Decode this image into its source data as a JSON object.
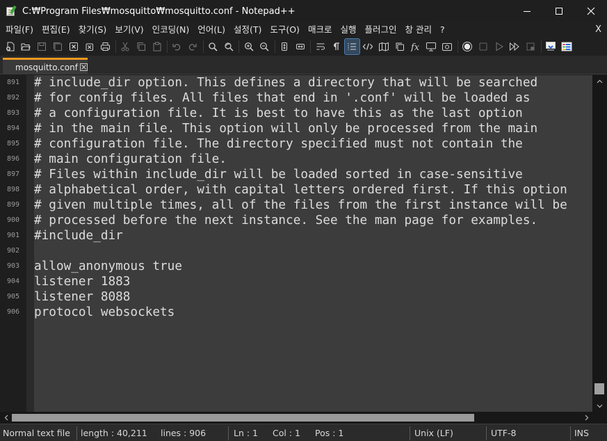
{
  "window": {
    "title": "C:₩Program Files₩mosquitto₩mosquitto.conf - Notepad++",
    "minimize_icon": "minimize-icon",
    "maximize_icon": "maximize-icon",
    "close_icon": "close-icon"
  },
  "menu": {
    "items": [
      "파일(F)",
      "편집(E)",
      "찾기(S)",
      "보기(V)",
      "인코딩(N)",
      "언어(L)",
      "설정(T)",
      "도구(O)",
      "매크로",
      "실행",
      "플러그인",
      "창 관리",
      "?"
    ],
    "close_label": "X"
  },
  "toolbar": {
    "groups": [
      [
        "new-file-icon",
        "open-file-icon",
        "save-icon",
        "save-all-icon",
        "close-icon",
        "close-all-icon",
        "print-icon"
      ],
      [
        "cut-icon",
        "copy-icon",
        "paste-icon"
      ],
      [
        "undo-icon",
        "redo-icon"
      ],
      [
        "find-icon",
        "replace-icon"
      ],
      [
        "zoom-in-icon",
        "zoom-out-icon"
      ],
      [
        "sync-vertical-icon",
        "sync-horizontal-icon"
      ],
      [
        "word-wrap-icon",
        "show-all-characters-icon",
        "indent-guide-icon",
        "xml-tag-icon",
        "document-map-icon",
        "document-list-icon",
        "function-list-icon",
        "monitoring-icon",
        "folder-workspace-icon"
      ],
      [
        "record-macro-icon",
        "stop-recording-icon",
        "play-macro-icon",
        "run-macro-multiple-icon",
        "save-macro-icon"
      ],
      [
        "panel-icon",
        "color-panel-icon"
      ]
    ],
    "active": "indent-guide-icon"
  },
  "tab": {
    "label": "mosquitto.conf",
    "close_icon": "tab-close-icon",
    "accent": "#f59a1f"
  },
  "editor": {
    "lines": [
      {
        "no": "891",
        "text": "# include_dir option. This defines a directory that will be searched"
      },
      {
        "no": "892",
        "text": "# for config files. All files that end in '.conf' will be loaded as"
      },
      {
        "no": "893",
        "text": "# a configuration file. It is best to have this as the last option"
      },
      {
        "no": "894",
        "text": "# in the main file. This option will only be processed from the main"
      },
      {
        "no": "895",
        "text": "# configuration file. The directory specified must not contain the"
      },
      {
        "no": "896",
        "text": "# main configuration file."
      },
      {
        "no": "897",
        "text": "# Files within include_dir will be loaded sorted in case-sensitive"
      },
      {
        "no": "898",
        "text": "# alphabetical order, with capital letters ordered first. If this option"
      },
      {
        "no": "899",
        "text": "# given multiple times, all of the files from the first instance will be"
      },
      {
        "no": "900",
        "text": "# processed before the next instance. See the man page for examples."
      },
      {
        "no": "901",
        "text": "#include_dir"
      },
      {
        "no": "902",
        "text": ""
      },
      {
        "no": "903",
        "text": "allow_anonymous true"
      },
      {
        "no": "904",
        "text": "listener 1883"
      },
      {
        "no": "905",
        "text": "listener 8088"
      },
      {
        "no": "906",
        "text": "protocol websockets"
      }
    ]
  },
  "status": {
    "file_type": "Normal text file",
    "length": "length : 40,211",
    "lines": "lines : 906",
    "ln": "Ln : 1",
    "col": "Col : 1",
    "pos": "Pos : 1",
    "eol": "Unix (LF)",
    "encoding": "UTF-8",
    "mode": "INS"
  }
}
